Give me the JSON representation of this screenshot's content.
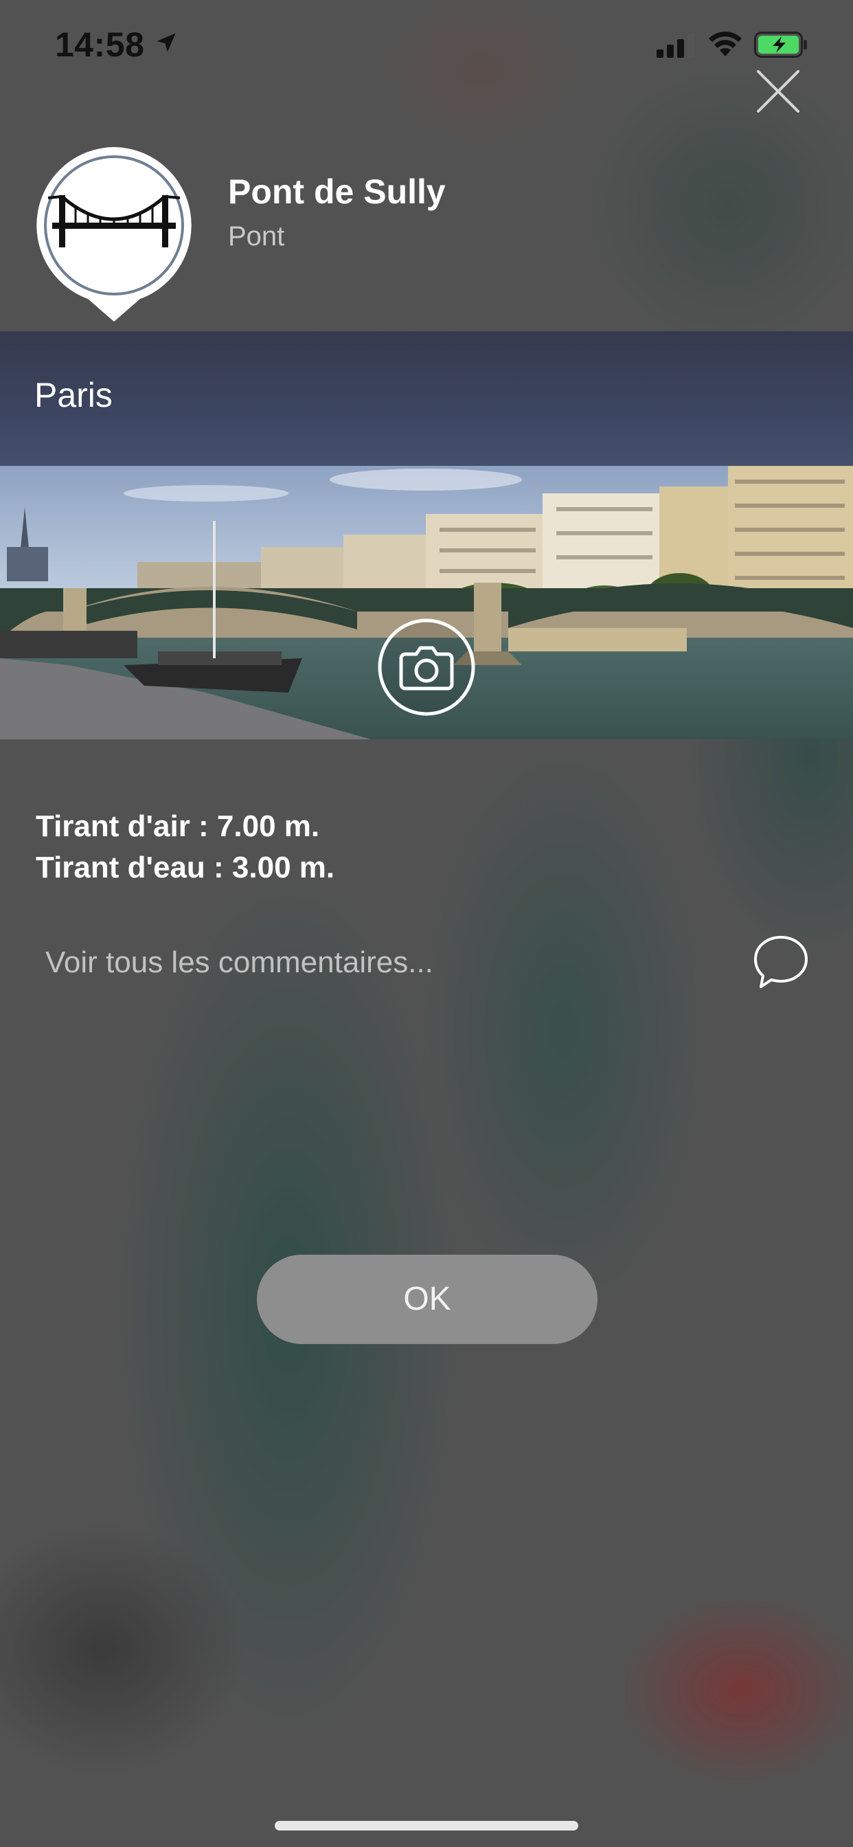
{
  "status_bar": {
    "time": "14:58",
    "location_icon": "location-arrow-icon",
    "signal_icon": "cellular-signal-icon",
    "wifi_icon": "wifi-icon",
    "battery_icon": "battery-charging-icon",
    "battery_color": "#4cd964"
  },
  "header": {
    "close_icon": "close-icon",
    "marker_icon": "suspension-bridge-icon",
    "title": "Pont de Sully",
    "subtitle": "Pont"
  },
  "city_band": {
    "label": "Paris"
  },
  "photo": {
    "camera_icon": "camera-icon"
  },
  "info": {
    "air_draft": "Tirant d'air : 7.00 m.",
    "draft": "Tirant d'eau : 3.00 m."
  },
  "comments": {
    "link_label": "Voir tous les commentaires...",
    "icon": "speech-bubble-icon"
  },
  "actions": {
    "ok_label": "OK"
  }
}
